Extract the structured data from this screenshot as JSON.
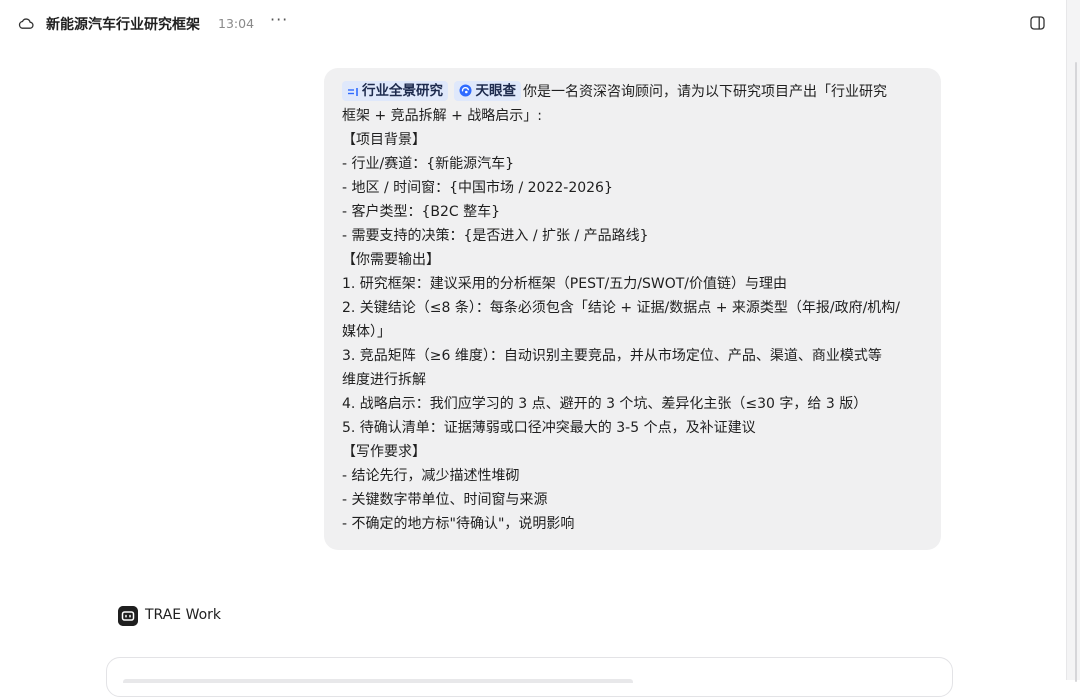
{
  "header": {
    "title": "新能源汽车行业研究框架",
    "time": "13:04",
    "more_label": "···"
  },
  "icons": {
    "cloud": "cloud-icon",
    "more": "more-horizontal-icon",
    "panel": "sidebar-panel-icon",
    "tag1": "list-icon",
    "tag2": "tianyancha-logo-icon",
    "agent": "chat-bubble-icon"
  },
  "colors": {
    "bubble_bg": "#f0f0f1",
    "tag_bg": "#dfe8fb",
    "tag_icon": "#2f6bff"
  },
  "message": {
    "tags": [
      "行业全景研究",
      "天眼查"
    ],
    "lines": [
      "你是一名资深咨询顾问，请为以下研究项目产出「行业研究",
      "框架 + 竞品拆解 + 战略启示」:",
      "【项目背景】",
      "- 行业/赛道：{新能源汽车}",
      "- 地区 / 时间窗：{中国市场 / 2022-2026}",
      "- 客户类型：{B2C 整车}",
      "- 需要支持的决策：{是否进入 / 扩张 / 产品路线}",
      "【你需要输出】",
      "1. 研究框架：建议采用的分析框架（PEST/五力/SWOT/价值链）与理由",
      "2. 关键结论（≤8 条）：每条必须包含「结论 + 证据/数据点 + 来源类型（年报/政府/机构/",
      "媒体）」",
      "3. 竞品矩阵（≥6 维度）：自动识别主要竞品，并从市场定位、产品、渠道、商业模式等",
      "维度进行拆解",
      "4. 战略启示：我们应学习的 3 点、避开的 3 个坑、差异化主张（≤30 字，给 3 版）",
      "5. 待确认清单：证据薄弱或口径冲突最大的 3-5 个点，及补证建议",
      "【写作要求】",
      "- 结论先行，减少描述性堆砌",
      "- 关键数字带单位、时间窗与来源",
      "- 不确定的地方标\"待确认\"，说明影响"
    ]
  },
  "agent": {
    "name": "TRAE Work"
  }
}
